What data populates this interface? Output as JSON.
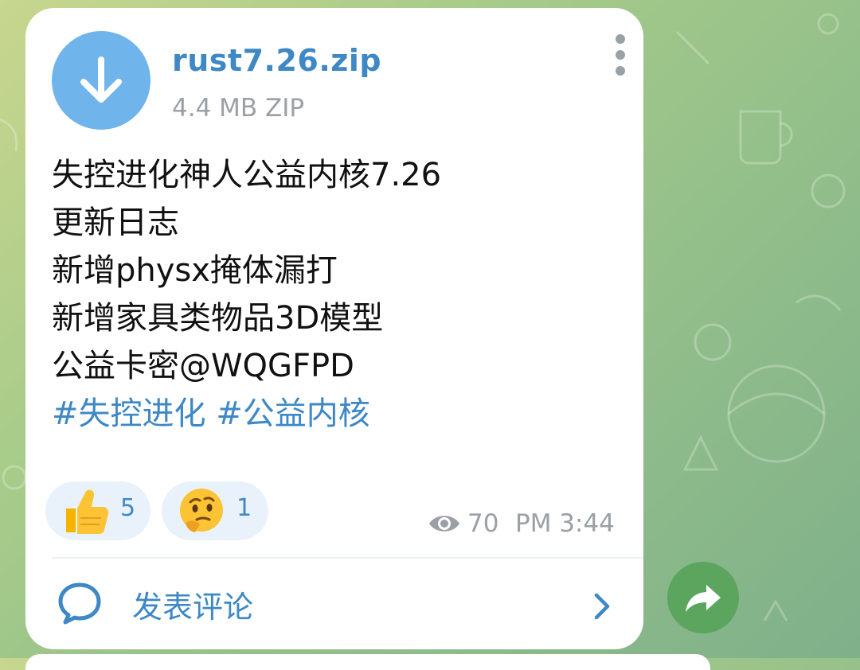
{
  "file": {
    "name": "rust7.26.zip",
    "meta": "4.4 MB ZIP",
    "download_icon": "download-arrow-icon"
  },
  "message": {
    "lines": [
      "失控进化神人公益内核7.26",
      "更新日志",
      "新增physx掩体漏打",
      "新增家具类物品3D模型",
      "公益卡密@WQGFPD"
    ],
    "tags": [
      "#失控进化",
      "#公益内核"
    ]
  },
  "reactions": [
    {
      "emoji": "👍",
      "icon": "thumbs-up-icon",
      "count": "5"
    },
    {
      "emoji": "🤔",
      "icon": "thinking-face-icon",
      "count": "1"
    }
  ],
  "footer": {
    "views": "70",
    "time": "PM 3:44"
  },
  "comments": {
    "label": "发表评论"
  },
  "colors": {
    "accent": "#3e88c5",
    "file_button": "#6fb4ea",
    "share_button": "#5ba55f",
    "meta_gray": "#9aa0a6",
    "reaction_bg": "#e9f2fb"
  }
}
